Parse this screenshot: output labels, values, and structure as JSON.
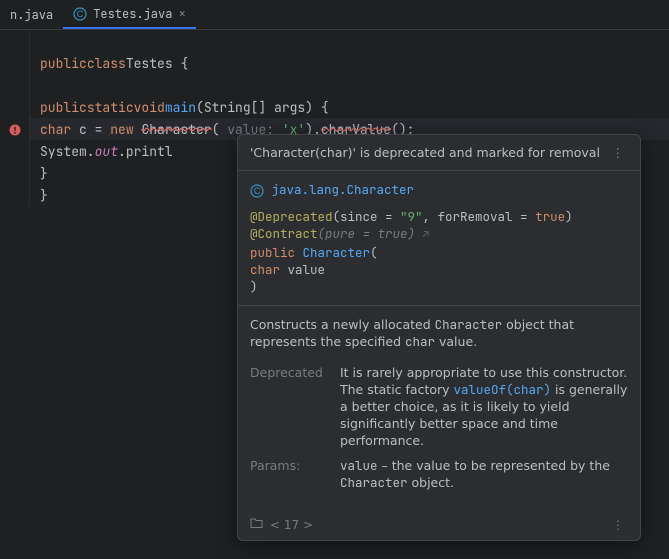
{
  "tabs": {
    "inactive": {
      "label": "n.java"
    },
    "active": {
      "label": "Testes.java",
      "icon": "java-class-icon"
    }
  },
  "code": {
    "l1": {
      "kw1": "public",
      "kw2": "class",
      "name": "Testes",
      "brace": " {"
    },
    "l2": {
      "kw1": "public",
      "kw2": "static",
      "kw3": "void",
      "fn": "main",
      "params": "(String[] args) {"
    },
    "l3": {
      "kw1": "char",
      "var": " c = ",
      "kw2": "new",
      "sp": " ",
      "ctor": "Character",
      "open": "( ",
      "inlay": "value: ",
      "str": "'x'",
      "close": ").",
      "call": "charValue",
      "end": "();"
    },
    "l4": {
      "pre": "System.",
      "field": "out",
      "post": ".printl"
    },
    "l5": {
      "brace": "}"
    },
    "l6": {
      "brace": "}"
    }
  },
  "tooltip": {
    "title": "'Character(char)' is deprecated and marked for removal",
    "fqcn": "java.lang.Character",
    "sig": {
      "anno1": "@Deprecated",
      "anno1_args_open": "(since = ",
      "since": "\"9\"",
      "anno1_mid": ", forRemoval = ",
      "trueVal": "true",
      "anno1_close": ")",
      "anno2": "@Contract",
      "anno2_args": "(pure = true)",
      "pub": "public",
      "name": "Character",
      "open": "(",
      "p_type": "char",
      "p_name": " value",
      "close": ")"
    },
    "desc1": "Constructs a newly allocated ",
    "desc1_code": "Character",
    "desc1b": " object that represents the specified ",
    "desc1_code2": "char",
    "desc1c": " value.",
    "rows": {
      "deprecated_label": "Deprecated",
      "deprecated_text1": "It is rarely appropriate to use this constructor. The static factory ",
      "deprecated_link": "valueOf(char)",
      "deprecated_text2": " is generally a better choice, as it is likely to yield significantly better space and time performance.",
      "params_label": "Params:",
      "params_name": "value",
      "params_text1": " – the value to be represented by the ",
      "params_code": "Character",
      "params_text2": " object."
    },
    "footer_nav": "< 17 >"
  }
}
